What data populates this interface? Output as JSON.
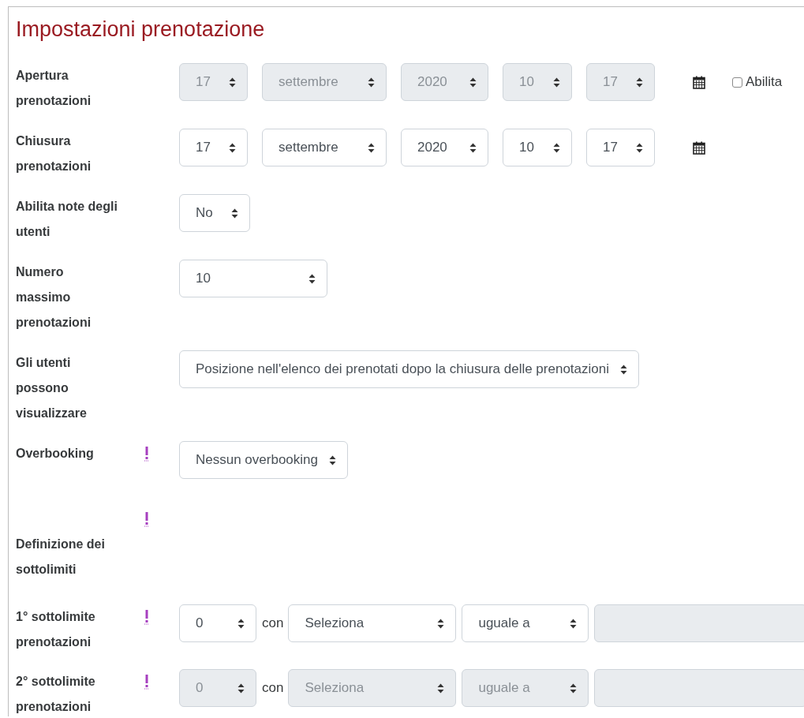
{
  "title": "Impostazioni prenotazione",
  "rows": [
    {
      "kind": "datetime",
      "label": "Apertura\nprenotazioni",
      "required": false,
      "disabled": true,
      "selects": [
        "17",
        "settembre",
        "2020",
        "10",
        "17"
      ],
      "enable_checkbox": {
        "label": "Abilita",
        "checked": false
      }
    },
    {
      "kind": "datetime",
      "label": "Chiusura\nprenotazioni",
      "required": false,
      "disabled": false,
      "selects": [
        "17",
        "settembre",
        "2020",
        "10",
        "17"
      ]
    },
    {
      "kind": "select",
      "label": "Abilita note degli\nutenti",
      "required": false,
      "disabled": false,
      "value": "No"
    },
    {
      "kind": "select",
      "label": "Numero\nmassimo\nprenotazioni",
      "required": false,
      "disabled": false,
      "value": "10"
    },
    {
      "kind": "select",
      "label": "Gli utenti\npossono\nvisualizzare",
      "required": false,
      "disabled": false,
      "value": "Posizione nell'elenco dei prenotati dopo la chiusura delle prenotazioni"
    },
    {
      "kind": "select",
      "label": "Overbooking",
      "required": true,
      "disabled": false,
      "value": "Nessun overbooking"
    },
    {
      "kind": "heading",
      "label": "Definizione dei\nsottolimiti",
      "required": true
    },
    {
      "kind": "sublimit",
      "label": "1° sottolimite\nprenotazioni",
      "required": true,
      "disabled": false,
      "count": "0",
      "connector": "con",
      "field": "Seleziona",
      "operator": "uguale a",
      "input_disabled": true
    },
    {
      "kind": "sublimit",
      "label": "2° sottolimite\nprenotazioni",
      "required": true,
      "disabled": true,
      "count": "0",
      "connector": "con",
      "field": "Seleziona",
      "operator": "uguale a",
      "input_disabled": true
    }
  ]
}
